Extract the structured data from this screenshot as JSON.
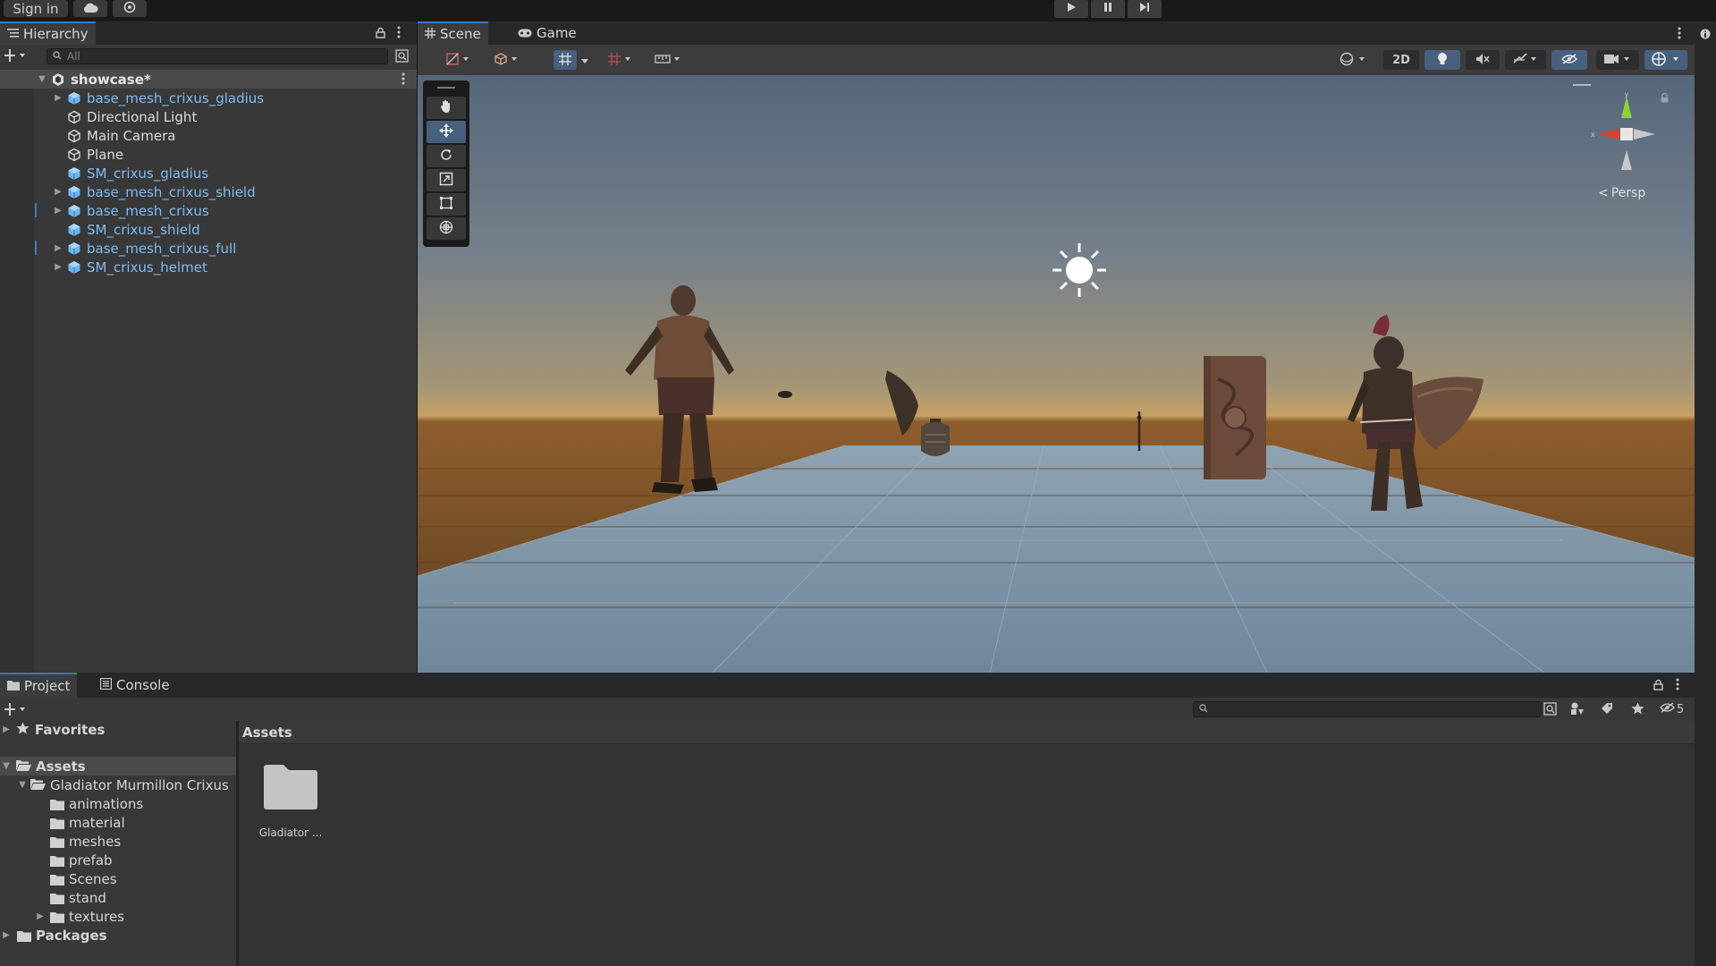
{
  "topbar": {
    "sign_in": "Sign in"
  },
  "hierarchy": {
    "tab_label": "Hierarchy",
    "search_placeholder": "All",
    "scene_name": "showcase*",
    "items": [
      {
        "label": "base_mesh_crixus_gladius",
        "type": "prefab",
        "expandable": true
      },
      {
        "label": "Directional Light",
        "type": "object",
        "expandable": false
      },
      {
        "label": "Main Camera",
        "type": "object",
        "expandable": false
      },
      {
        "label": "Plane",
        "type": "object",
        "expandable": false
      },
      {
        "label": "SM_crixus_gladius",
        "type": "prefab",
        "expandable": false
      },
      {
        "label": "base_mesh_crixus_shield",
        "type": "prefab",
        "expandable": true
      },
      {
        "label": "base_mesh_crixus",
        "type": "prefab",
        "expandable": true
      },
      {
        "label": "SM_crixus_shield",
        "type": "prefab",
        "expandable": false
      },
      {
        "label": "base_mesh_crixus_full",
        "type": "prefab",
        "expandable": true
      },
      {
        "label": "SM_crixus_helmet",
        "type": "prefab",
        "expandable": true
      }
    ]
  },
  "scene": {
    "tabs": [
      {
        "label": "Scene",
        "icon": "grid-icon",
        "active": true
      },
      {
        "label": "Game",
        "icon": "gamepad-icon",
        "active": false
      }
    ],
    "toolbar_2d": "2D",
    "projection_label": "Persp",
    "gizmo_y": "y",
    "gizmo_x": "x"
  },
  "project": {
    "tabs": [
      {
        "label": "Project",
        "icon": "folder-icon",
        "active": true
      },
      {
        "label": "Console",
        "icon": "console-icon",
        "active": false
      }
    ],
    "hidden_count": "5",
    "favorites_label": "Favorites",
    "assets_label": "Assets",
    "packages_label": "Packages",
    "tree": {
      "root_folder": "Gladiator Murmillon Crixus",
      "children": [
        "animations",
        "material",
        "meshes",
        "prefab",
        "Scenes",
        "stand",
        "textures"
      ]
    },
    "breadcrumb": "Assets",
    "grid_items": [
      {
        "label": "Gladiator ...",
        "icon": "folder-icon"
      }
    ]
  },
  "colors": {
    "accent": "#3a79bb",
    "prefab_text": "#7ebcf4",
    "selected_button": "#46607e"
  }
}
